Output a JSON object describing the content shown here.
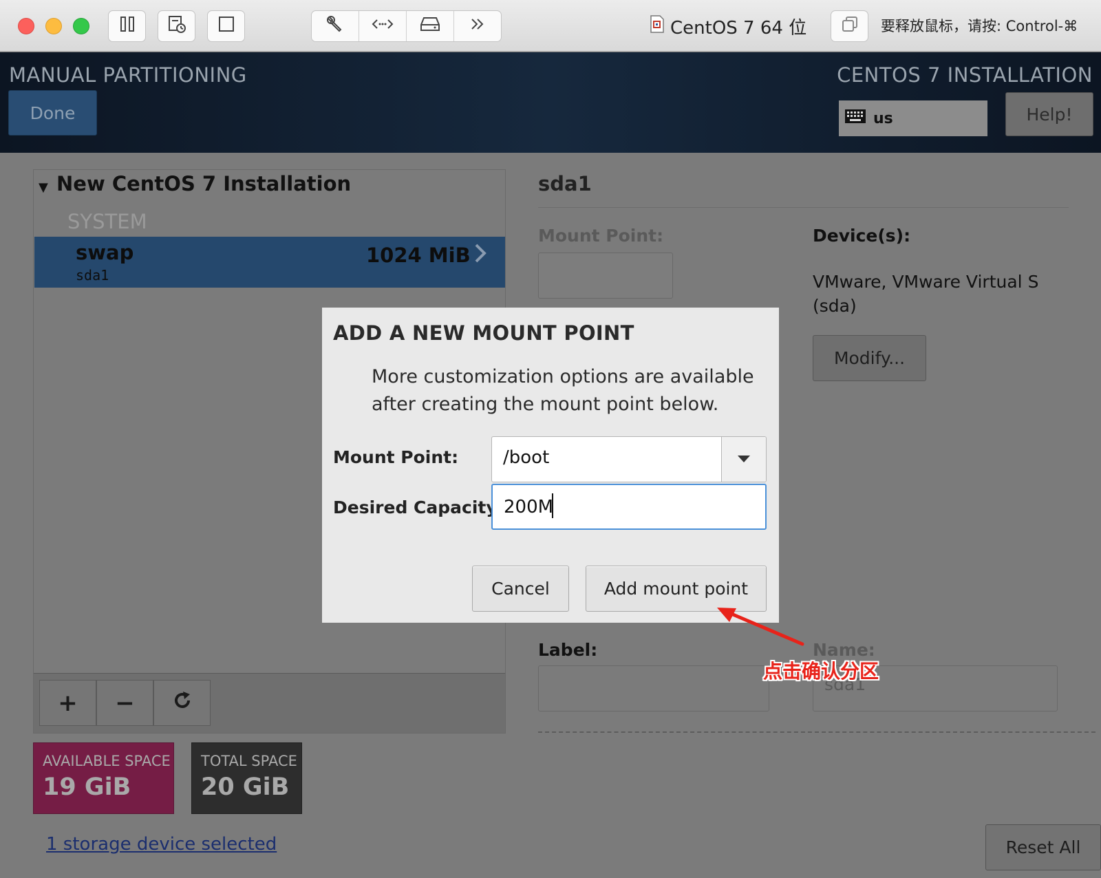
{
  "vm_window": {
    "title": "CentOS 7 64 位",
    "release_hint": "要释放鼠标，请按: Control-⌘"
  },
  "installer_header": {
    "screen_title": "MANUAL PARTITIONING",
    "product": "CENTOS 7 INSTALLATION",
    "done_label": "Done",
    "keyboard_layout": "us",
    "help_label": "Help!"
  },
  "partition_list": {
    "installation_name": "New CentOS 7 Installation",
    "section": "SYSTEM",
    "items": [
      {
        "name": "swap",
        "device": "sda1",
        "size": "1024 MiB"
      }
    ],
    "add_label": "+",
    "remove_label": "−"
  },
  "space": {
    "available_label": "AVAILABLE SPACE",
    "available_value": "19 GiB",
    "total_label": "TOTAL SPACE",
    "total_value": "20 GiB",
    "storage_link": "1 storage device selected",
    "reset_label": "Reset All"
  },
  "details": {
    "title": "sda1",
    "mount_point_label": "Mount Point:",
    "devices_label": "Device(s):",
    "device_name": "VMware, VMware Virtual S (sda)",
    "modify_label": "Modify...",
    "label_label": "Label:",
    "name_label": "Name:",
    "name_value": "sda1"
  },
  "dialog": {
    "title": "ADD A NEW MOUNT POINT",
    "description": "More customization options are available after creating the mount point below.",
    "mount_point_label": "Mount Point:",
    "mount_point_value": "/boot",
    "capacity_label": "Desired Capacity:",
    "capacity_value": "200M",
    "cancel_label": "Cancel",
    "add_label": "Add mount point"
  },
  "annotation": {
    "text": "点击确认分区",
    "color": "#e8231a"
  },
  "colors": {
    "selected_row": "#25486d",
    "available_space": "#751d45",
    "total_space": "#2d2d2d",
    "focus_border": "#4a90d9"
  }
}
